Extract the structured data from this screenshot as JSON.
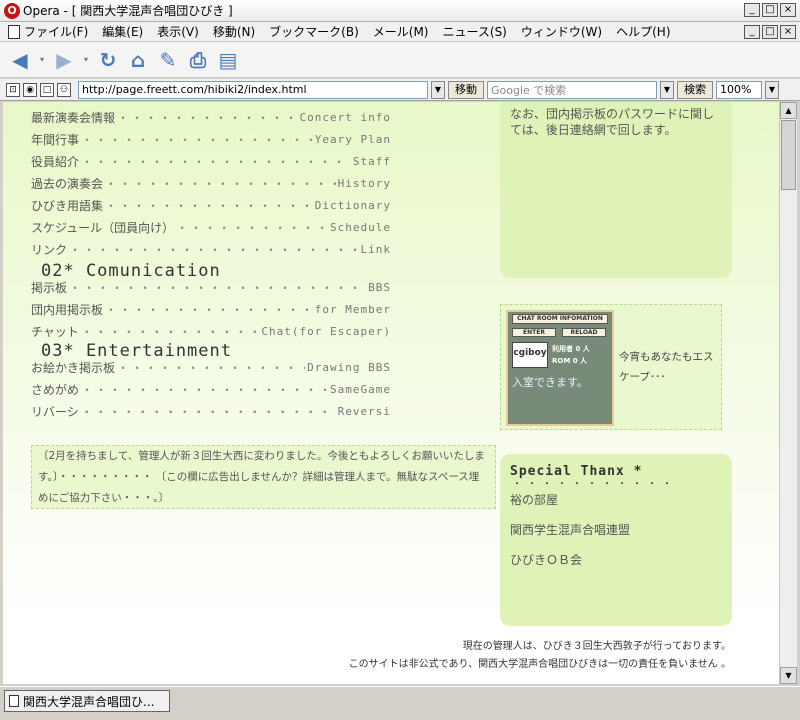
{
  "window": {
    "title": "Opera - [ 関西大学混声合唱団ひびき ]",
    "min": "_",
    "max": "□",
    "close": "×"
  },
  "menubar": {
    "items": [
      "ファイル(F)",
      "編集(E)",
      "表示(V)",
      "移動(N)",
      "ブックマーク(B)",
      "メール(M)",
      "ニュース(S)",
      "ウィンドウ(W)",
      "ヘルプ(H)"
    ]
  },
  "toolbar": {
    "icons": [
      "back-icon",
      "dropdown-icon",
      "forward-icon",
      "dropdown-icon",
      "reload-icon",
      "home-icon",
      "hotlist-icon",
      "print-icon",
      "page-icon"
    ]
  },
  "address": {
    "url": "http://page.freett.com/hibiki2/index.html",
    "go": "移動",
    "search_placeholder": "Google で検索",
    "search_btn": "検索",
    "zoom": "100%"
  },
  "content": {
    "menu_rows": [
      {
        "jp": "最新演奏会情報",
        "en": "Concert info"
      },
      {
        "jp": "年間行事",
        "en": "Yeary Plan"
      },
      {
        "jp": "役員紹介",
        "en": "Staff"
      },
      {
        "jp": "過去の演奏会",
        "en": "History"
      },
      {
        "jp": "ひびき用語集",
        "en": "Dictionary"
      },
      {
        "jp": "スケジュール（団員向け）",
        "en": "Schedule"
      },
      {
        "jp": "リンク",
        "en": "Link"
      }
    ],
    "section2": "02* Comunication",
    "menu_rows2": [
      {
        "jp": "掲示板",
        "en": "BBS"
      },
      {
        "jp": "団内用掲示板",
        "en": "for Member"
      },
      {
        "jp": "チャット",
        "en": "Chat(for Escaper)"
      }
    ],
    "section3": "03* Entertainment",
    "menu_rows3": [
      {
        "jp": "お絵かき掲示板",
        "en": "Drawing BBS"
      },
      {
        "jp": "さめがめ",
        "en": "SameGame"
      },
      {
        "jp": "リバーシ",
        "en": "Reversi"
      }
    ],
    "notice": "〔2月を持ちまして、管理人が新３回生大西に変わりました。今後ともよろしくお願いいたします。〕・・・・・・・・・ 〔この欄に広告出しませんか？詳細は管理人まで。無駄なスペース埋めにご協力下さい・・・。〕",
    "right_top": "なお、団内掲示板のパスワードに関しては、後日連絡網で回します。",
    "chat": {
      "title": "CHAT ROOM INFOMATION",
      "enter": "ENTER",
      "reload": "RELOAD",
      "logo": "cgiboy",
      "users_label": "利用者",
      "users_val": "0 人",
      "rom_label": "ROM",
      "rom_val": "0 人",
      "enter_text": "入室できます。",
      "side": "今宵もあなたもエスケープ･･･"
    },
    "thanks": {
      "head": "Special Thanx *",
      "dots": "・・・・・・・・・・・",
      "items": [
        "裕の部屋",
        "関西学生混声合唱連盟",
        "ひびきＯＢ会"
      ]
    },
    "footer1": "現在の管理人は、ひびき３回生大西敦子が行っております。",
    "footer2": "このサイトは非公式であり、関西大学混声合唱団ひびきは一切の責任を負いません 。"
  },
  "taskbar": {
    "tab": "関西大学混声合唱団ひ..."
  }
}
